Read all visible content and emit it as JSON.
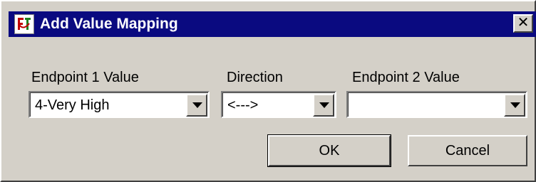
{
  "dialog": {
    "title": "Add Value Mapping",
    "close_label": "✕"
  },
  "fields": {
    "endpoint1": {
      "label": "Endpoint 1 Value",
      "value": "4-Very High"
    },
    "direction": {
      "label": "Direction",
      "value": "<--->"
    },
    "endpoint2": {
      "label": "Endpoint 2 Value",
      "value": ""
    }
  },
  "buttons": {
    "ok": "OK",
    "cancel": "Cancel"
  },
  "colors": {
    "titlebar": "#0a0a80",
    "face": "#d4d0c8"
  },
  "icons": {
    "app": "app-logo-icon",
    "close": "close-icon",
    "dropdown": "chevron-down-icon"
  }
}
